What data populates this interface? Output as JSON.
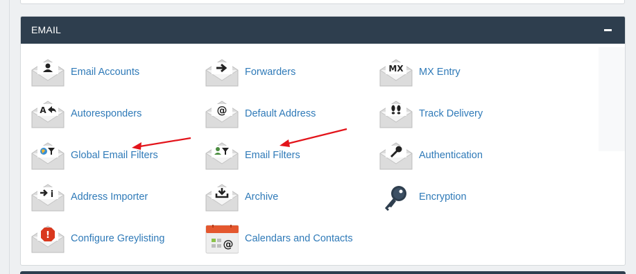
{
  "panel": {
    "title": "EMAIL"
  },
  "items": {
    "email_accounts": "Email Accounts",
    "forwarders": "Forwarders",
    "mx_entry": "MX Entry",
    "autoresponders": "Autoresponders",
    "default_address": "Default Address",
    "track_delivery": "Track Delivery",
    "global_email_filters": "Global Email Filters",
    "email_filters": "Email Filters",
    "authentication": "Authentication",
    "address_importer": "Address Importer",
    "archive": "Archive",
    "encryption": "Encryption",
    "configure_greylisting": "Configure Greylisting",
    "calendars_and_contacts": "Calendars and Contacts"
  },
  "icon_glyphs": {
    "mx_entry": "MX",
    "autoresponders": "A",
    "default_address": "@",
    "address_importer": "i",
    "configure_greylisting": "!",
    "calendars_and_contacts": "@"
  },
  "colors": {
    "header_bg": "#2e3e4e",
    "link": "#2f7ab8",
    "annotation_arrow": "#e3141b",
    "calendar_red": "#e4572e"
  }
}
